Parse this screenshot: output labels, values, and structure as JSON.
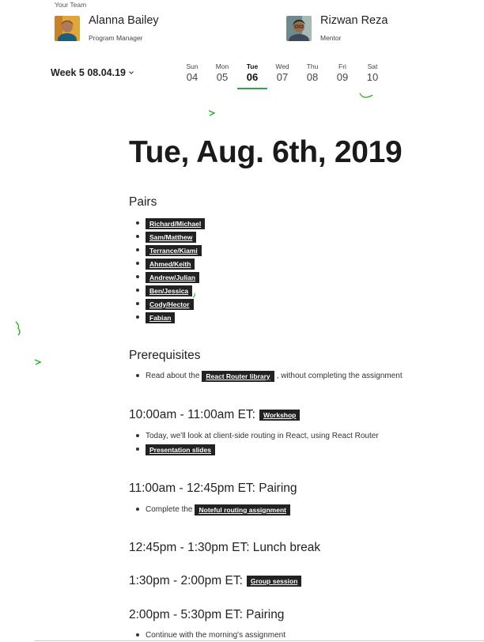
{
  "team": {
    "label": "Your Team",
    "members": [
      {
        "name": "Alanna Bailey",
        "role": "Program Manager"
      },
      {
        "name": "Rizwan Reza",
        "role": "Mentor"
      }
    ]
  },
  "week": {
    "label": "Week 5 08.04.19"
  },
  "days": [
    {
      "name": "Sun",
      "date": "04"
    },
    {
      "name": "Mon",
      "date": "05"
    },
    {
      "name": "Tue",
      "date": "06"
    },
    {
      "name": "Wed",
      "date": "07"
    },
    {
      "name": "Thu",
      "date": "08"
    },
    {
      "name": "Fri",
      "date": "09"
    },
    {
      "name": "Sat",
      "date": "10"
    }
  ],
  "page": {
    "title": "Tue, Aug. 6th, 2019"
  },
  "pairs": {
    "heading": "Pairs",
    "items": [
      "Richard/Michael",
      "Sam/Matthew",
      "Terrance/Kiami",
      "Ahmed/Keith",
      "Andrew/Julian",
      "Ben/Jessica",
      "Cody/Hector",
      "Fabian"
    ]
  },
  "prereq": {
    "heading": "Prerequisites",
    "pre": "Read about the",
    "link": "React Router library",
    "post": ", without completing the assignment"
  },
  "workshop": {
    "heading": "10:00am - 11:00am ET:",
    "tag": "Workshop",
    "bullet": "Today, we'll look at client-side routing in React, using React Router",
    "slides": "Presentation slides"
  },
  "pairing1": {
    "heading": "11:00am - 12:45pm ET: Pairing",
    "pre": "Complete the",
    "link": "Noteful routing assignment"
  },
  "lunch": {
    "heading": "12:45pm - 1:30pm ET: Lunch break"
  },
  "group": {
    "heading": "1:30pm - 2:00pm ET:",
    "tag": "Group session"
  },
  "pairing2": {
    "heading": "2:00pm - 5:30pm ET: Pairing",
    "bullet": "Continue with the morning's assignment"
  }
}
